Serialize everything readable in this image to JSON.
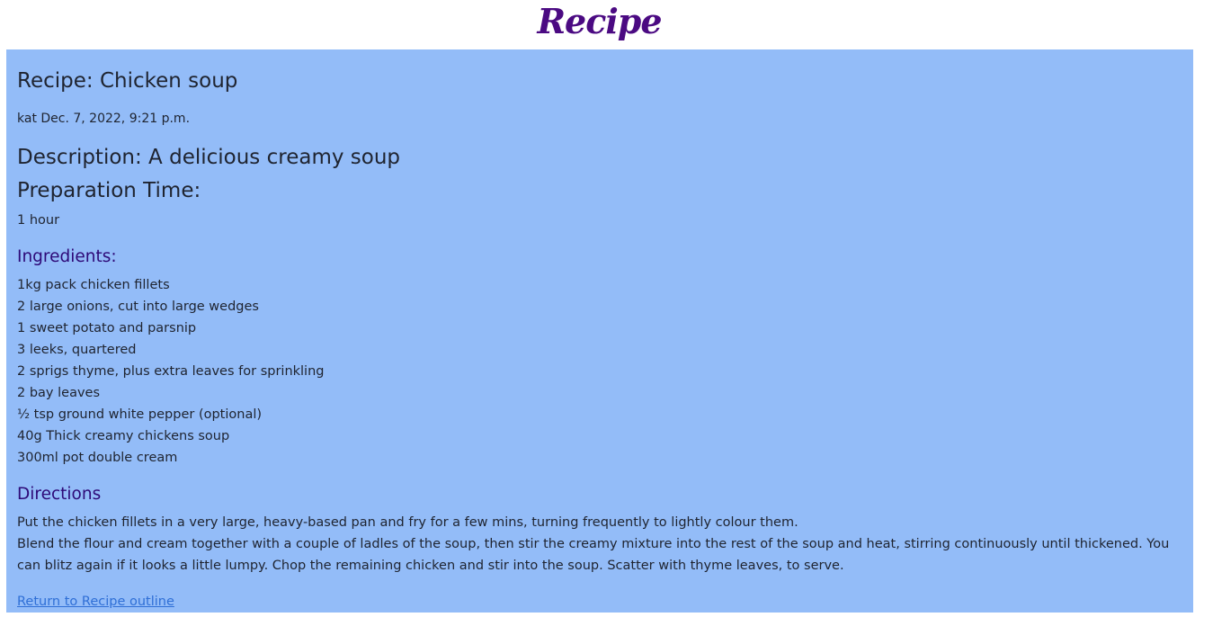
{
  "header": {
    "site_title": "Recipe"
  },
  "recipe": {
    "title": "Recipe: Chicken soup",
    "meta": "kat Dec. 7, 2022, 9:21 p.m.",
    "description": "Description: A delicious creamy soup",
    "prep_heading": "Preparation Time:",
    "prep_value": "1 hour",
    "ingredients_heading": "Ingredients:",
    "ingredients": [
      "1kg pack chicken fillets",
      "2 large onions, cut into large wedges",
      "1 sweet potato and parsnip",
      "3 leeks, quartered",
      "2 sprigs thyme, plus extra leaves for sprinkling",
      "2 bay leaves",
      "½ tsp ground white pepper (optional)",
      "40g Thick creamy chickens soup",
      "300ml pot double cream"
    ],
    "directions_heading": "Directions",
    "directions": [
      "Put the chicken fillets in a very large, heavy-based pan and fry for a few mins, turning frequently to lightly colour them.",
      "Blend the flour and cream together with a couple of ladles of the soup, then stir the creamy mixture into the rest of the soup and heat, stirring continuously until thickened. You can blitz again if it looks a little lumpy. Chop the remaining chicken and stir into the soup. Scatter with thyme leaves, to serve."
    ],
    "return_link": "Return to Recipe outline"
  },
  "colors": {
    "title": "#4b0a82",
    "card_background": "#93bcf8",
    "section_heading": "#2e0a78",
    "link": "#2f6fd6"
  }
}
